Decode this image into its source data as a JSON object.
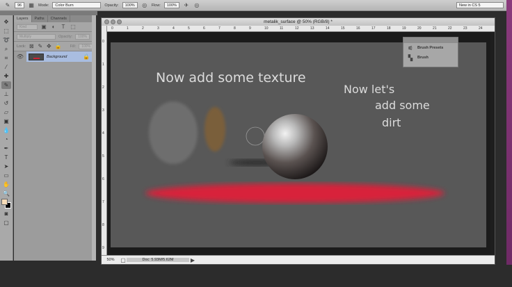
{
  "options_bar": {
    "brush_size": "96",
    "mode_label": "Mode:",
    "mode_value": "Color Burn",
    "opacity_label": "Opacity:",
    "opacity_value": "100%",
    "flow_label": "Flow:",
    "flow_value": "100%",
    "workspace": "New in CS 5"
  },
  "layers_panel": {
    "tabs": [
      "Layers",
      "Paths",
      "Channels"
    ],
    "kind": "Kind",
    "blend_mode": "Multiply",
    "opacity_label": "Opacity:",
    "opacity_value": "100%",
    "lock_label": "Lock:",
    "fill_label": "Fill:",
    "fill_value": "100%",
    "layer_name": "Background"
  },
  "document": {
    "title": "metalik_surface @ 50% (RGB/8) *",
    "zoom": "50%",
    "doc_info": "Doc: 5.93M/5.62M",
    "h_ruler": [
      "0",
      "1",
      "2",
      "3",
      "4",
      "5",
      "6",
      "7",
      "8",
      "9",
      "10",
      "11",
      "12",
      "13",
      "14",
      "15",
      "16",
      "17",
      "18",
      "19",
      "20",
      "21",
      "22",
      "23",
      "24"
    ],
    "v_ruler": [
      "0",
      "1",
      "2",
      "3",
      "4",
      "5",
      "6",
      "7",
      "8",
      "9"
    ]
  },
  "canvas_text": {
    "line1": "Now add some texture",
    "line2a": "Now let's",
    "line2b": "add some",
    "line2c": "dirt"
  },
  "brush_panel": {
    "items": [
      "Brush Presets",
      "Brush"
    ]
  },
  "colors": {
    "foreground": "#f7dcb8",
    "background": "#000000",
    "canvas": "#585858",
    "stroke": "#d8203a"
  }
}
